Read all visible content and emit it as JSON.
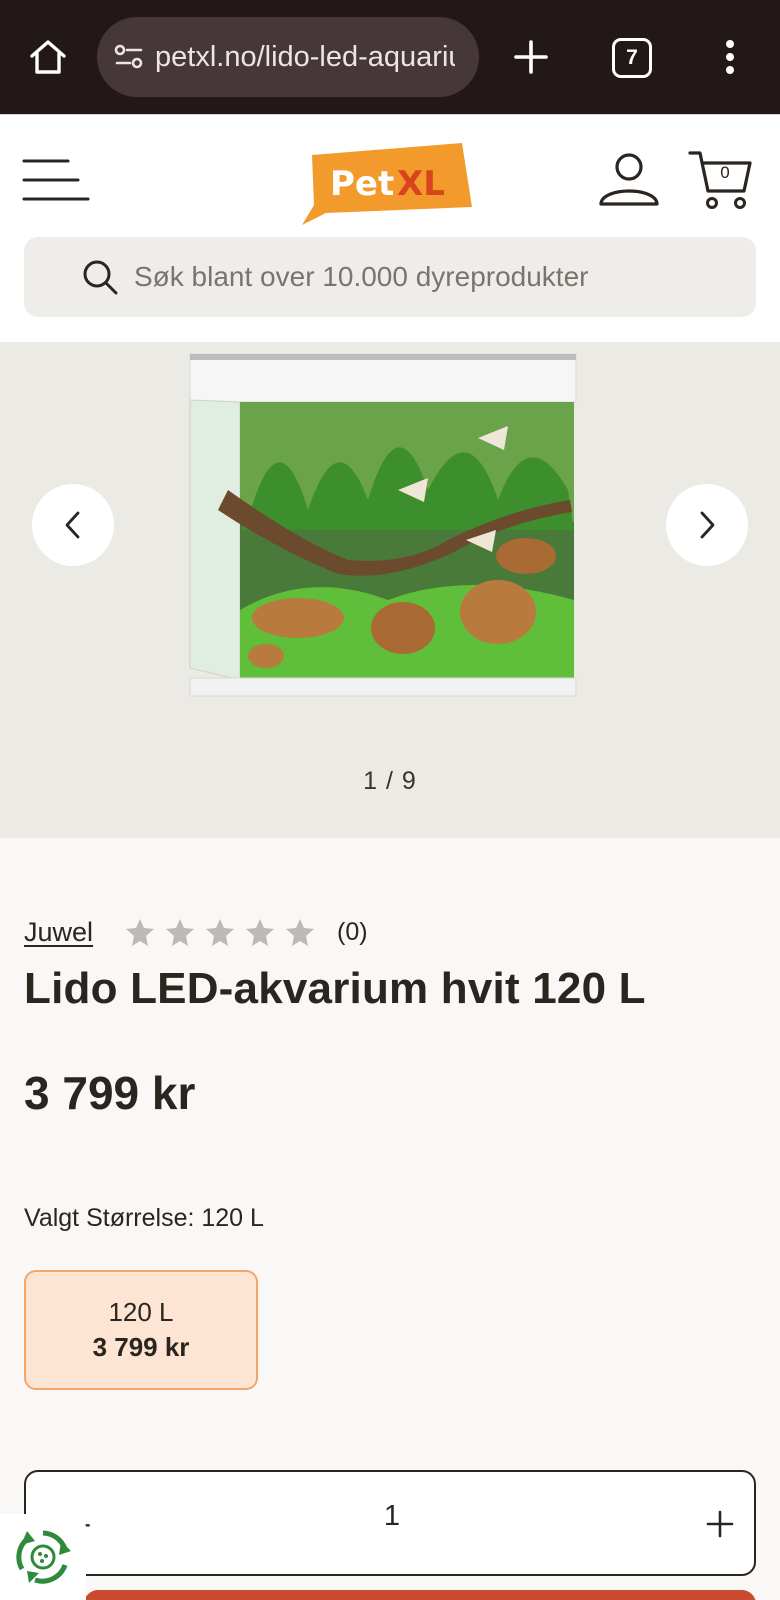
{
  "browser": {
    "url": "petxl.no/lido-led-aquarium",
    "tab_count": "7",
    "icons": [
      "home-icon",
      "site-info-icon",
      "plus-icon",
      "tabs-icon",
      "more-vert-icon"
    ]
  },
  "header": {
    "logo_text_pet": "Pet",
    "logo_text_xl": "XL",
    "cart_count": "0",
    "search_placeholder": "Søk blant over 10.000 dyreprodukter",
    "colors": {
      "logo_orange": "#f39a2c",
      "logo_red": "#d9431e"
    }
  },
  "gallery": {
    "counter": "1 / 9",
    "image_name": "aquarium-photo"
  },
  "product": {
    "brand": "Juwel",
    "rating_stars": 0,
    "rating_max": 5,
    "review_count": "(0)",
    "title": "Lido LED-akvarium hvit 120 L",
    "price": "3 799 kr",
    "variant_label": "Valgt Størrelse: 120 L",
    "variants": [
      {
        "size": "120 L",
        "price": "3 799 kr",
        "selected": true
      }
    ]
  },
  "quantity": {
    "minus_label": "-",
    "value": "1"
  },
  "colors": {
    "accent": "#c94a2c",
    "variant_bg": "#fde4d3",
    "variant_border": "#f2a66a"
  }
}
